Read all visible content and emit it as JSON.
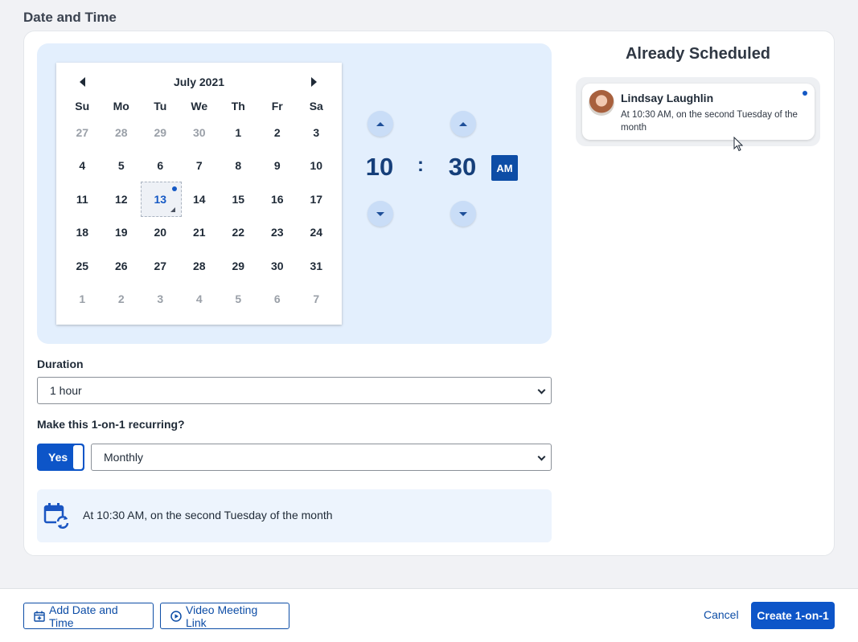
{
  "section_title": "Date and Time",
  "calendar": {
    "month_label": "July 2021",
    "weekdays": [
      "Su",
      "Mo",
      "Tu",
      "We",
      "Th",
      "Fr",
      "Sa"
    ],
    "weeks": [
      [
        "27",
        "28",
        "29",
        "30",
        "1",
        "2",
        "3"
      ],
      [
        "4",
        "5",
        "6",
        "7",
        "8",
        "9",
        "10"
      ],
      [
        "11",
        "12",
        "13",
        "14",
        "15",
        "16",
        "17"
      ],
      [
        "18",
        "19",
        "20",
        "21",
        "22",
        "23",
        "24"
      ],
      [
        "25",
        "26",
        "27",
        "28",
        "29",
        "30",
        "31"
      ],
      [
        "1",
        "2",
        "3",
        "4",
        "5",
        "6",
        "7"
      ]
    ],
    "muted_first_row": [
      0,
      1,
      2,
      3
    ],
    "muted_last_row": [
      0,
      1,
      2,
      3,
      4,
      5,
      6
    ],
    "selected": "13"
  },
  "time": {
    "hour": "10",
    "separator": ":",
    "minute": "30",
    "period": "AM"
  },
  "duration": {
    "label": "Duration",
    "value": "1 hour"
  },
  "recurring": {
    "label": "Make this 1-on-1 recurring?",
    "toggle_label": "Yes",
    "frequency": "Monthly"
  },
  "summary": {
    "text": "At 10:30 AM, on the second Tuesday of the month"
  },
  "already_scheduled": {
    "title": "Already Scheduled",
    "items": [
      {
        "name": "Lindsay Laughlin",
        "description": "At 10:30 AM, on the second Tuesday of the month"
      }
    ]
  },
  "footer": {
    "add_date_label": "Add Date and Time",
    "video_link_label": "Video Meeting Link",
    "cancel_label": "Cancel",
    "create_label": "Create 1-on-1"
  },
  "colors": {
    "accent": "#0d55c8",
    "panel": "#e3effd",
    "time_text": "#163f7a"
  }
}
